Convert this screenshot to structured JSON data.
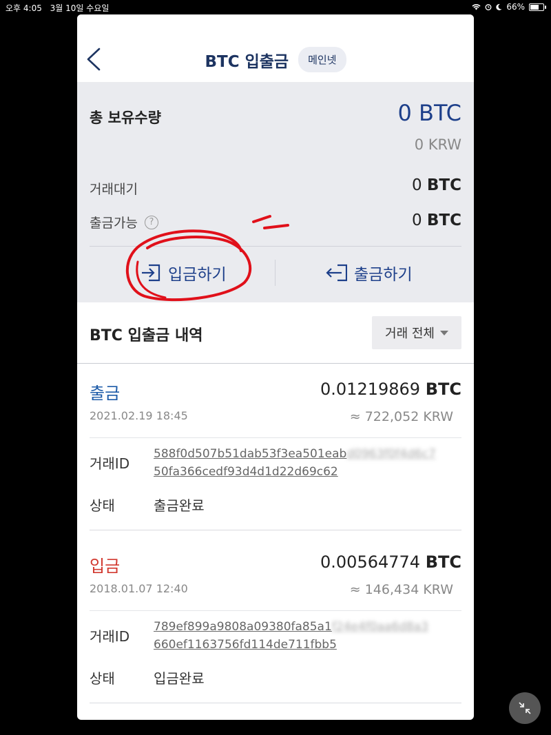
{
  "status_bar": {
    "time": "오후 4:05",
    "date": "3월 10일 수요일",
    "battery": "66%",
    "battery_level": 0.66
  },
  "header": {
    "back_icon": "chevron-left-icon",
    "title": "BTC 입출금",
    "network_badge": "메인넷"
  },
  "summary": {
    "total_label": "총 보유수량",
    "total_btc": "0 BTC",
    "total_krw": "0 KRW",
    "pending_label": "거래대기",
    "pending_value": "0",
    "withdrawable_label": "출금가능",
    "withdrawable_value": "0",
    "unit": "BTC",
    "help_icon": "question-circle-icon"
  },
  "actions": {
    "deposit_label": "입금하기",
    "deposit_icon": "login-arrow-icon",
    "withdraw_label": "출금하기",
    "withdraw_icon": "logout-arrow-icon"
  },
  "history": {
    "title": "BTC 입출금 내역",
    "filter_label": "거래 전체",
    "transactions": [
      {
        "type": "출금",
        "amount": "0.01219869",
        "unit": "BTC",
        "date": "2021.02.19 18:45",
        "krw": "≈ 722,052 KRW",
        "id_label": "거래ID",
        "hash_line1": "588f0d507b51dab53f3ea501eab",
        "hash_blurred": "d0963f0f4d6c7",
        "hash_line2": "50fa366cedf93d4d1d22d69c62",
        "status_label": "상태",
        "status": "출금완료"
      },
      {
        "type": "입금",
        "amount": "0.00564774",
        "unit": "BTC",
        "date": "2018.01.07 12:40",
        "krw": "≈ 146,434 KRW",
        "id_label": "거래ID",
        "hash_line1": "789ef899a9808a09380fa85a1",
        "hash_blurred": "f24e4f0aa6d8a3",
        "hash_line2": "660ef1163756fd114de711fbb5",
        "status_label": "상태",
        "status": "입금완료"
      }
    ]
  },
  "colors": {
    "brand_navy": "#1d3461",
    "withdraw_blue": "#1d5ba8",
    "deposit_red": "#d23a30",
    "annotation_red": "#e0101a"
  }
}
